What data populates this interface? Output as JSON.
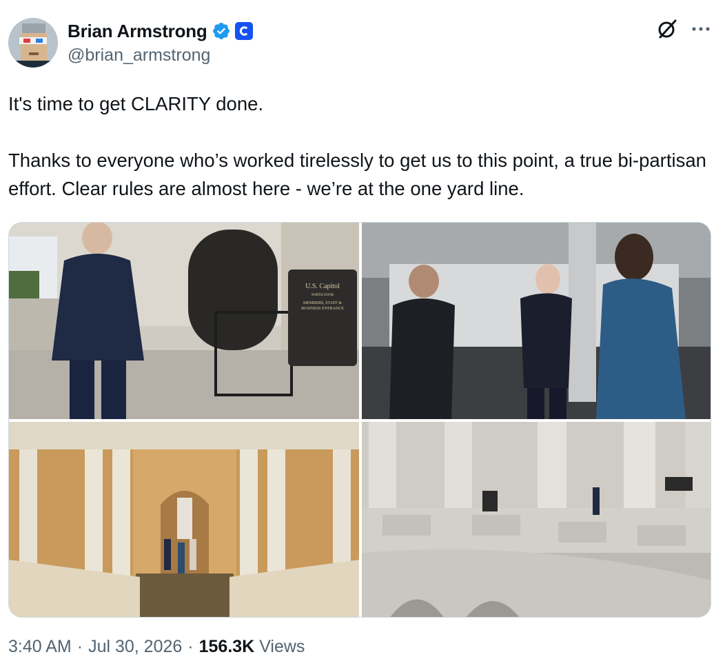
{
  "author": {
    "name": "Brian Armstrong",
    "handle": "@brian_armstrong"
  },
  "post": {
    "text": "It's time to get CLARITY done.\n\nThanks to everyone who’s worked tirelessly to get us to this point, a true bi-partisan effort. Clear rules are almost here - we’re at the one yard line."
  },
  "media": {
    "photo1_sign": {
      "line1": "U.S. Capitol",
      "line2": "NORTH DOOR",
      "line3": "MEMBERS, STAFF &",
      "line4": "BUSINESS ENTRANCE"
    }
  },
  "meta": {
    "time": "3:40 AM",
    "separator1": "·",
    "date": "Jul 30, 2026",
    "separator2": "·",
    "views_count": "156.3K",
    "views_label": "Views"
  },
  "colors": {
    "verified_blue": "#1d9bf0",
    "affiliate_blue": "#1652f0",
    "secondary_text": "#536471"
  },
  "icons": [
    "verified-badge-icon",
    "coinbase-logo-icon",
    "grok-icon",
    "more-icon"
  ]
}
